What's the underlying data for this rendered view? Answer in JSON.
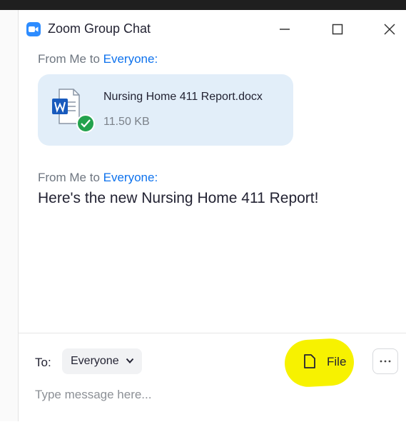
{
  "window": {
    "title": "Zoom Group Chat",
    "minimize_icon": "minimize-icon",
    "maximize_icon": "maximize-icon",
    "close_icon": "close-icon"
  },
  "chat": {
    "messages": [
      {
        "sender_prefix": "From Me to ",
        "recipient": "Everyone:",
        "type": "file",
        "file": {
          "name": "Nursing Home 411 Report.docx",
          "size": "11.50 KB",
          "icon": "word-document-icon",
          "status_icon": "checkmark-icon"
        }
      },
      {
        "sender_prefix": "From Me to ",
        "recipient": "Everyone:",
        "type": "text",
        "text": "Here's the new Nursing Home 411 Report!"
      }
    ]
  },
  "composer": {
    "to_label": "To:",
    "recipient": "Everyone",
    "file_label": "File",
    "more_label": "···",
    "placeholder": "Type message here..."
  },
  "colors": {
    "accent": "#0e72ed",
    "zoom_blue": "#2d8cff",
    "file_card_bg": "#e2eef9",
    "word_blue": "#185abd",
    "success_green": "#23a24d",
    "highlight_yellow": "#f7f200"
  }
}
